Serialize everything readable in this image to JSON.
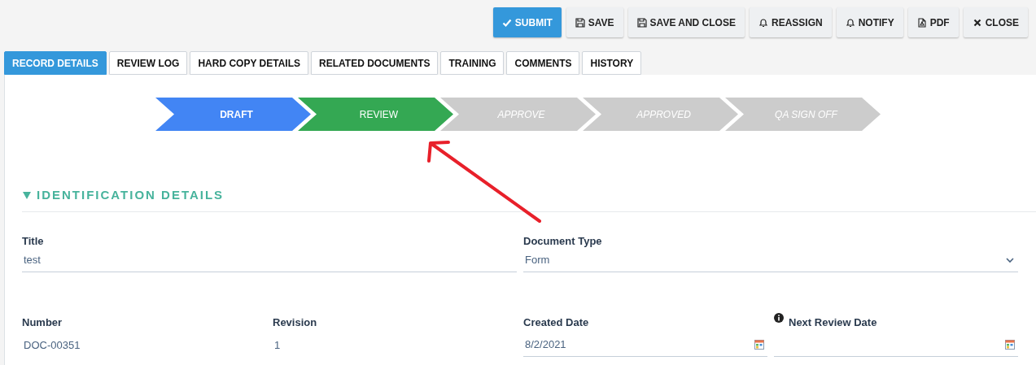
{
  "toolbar": [
    {
      "label": "SUBMIT",
      "primary": true
    },
    {
      "label": "SAVE",
      "primary": false
    },
    {
      "label": "SAVE AND CLOSE",
      "primary": false
    },
    {
      "label": "REASSIGN",
      "primary": false
    },
    {
      "label": "NOTIFY",
      "primary": false
    },
    {
      "label": "PDF",
      "primary": false
    },
    {
      "label": "CLOSE",
      "primary": false
    }
  ],
  "tabs": [
    {
      "label": "RECORD DETAILS",
      "selected": true
    },
    {
      "label": "REVIEW LOG",
      "selected": false
    },
    {
      "label": "HARD COPY DETAILS",
      "selected": false
    },
    {
      "label": "RELATED DOCUMENTS",
      "selected": false
    },
    {
      "label": "TRAINING",
      "selected": false
    },
    {
      "label": "COMMENTS",
      "selected": false
    },
    {
      "label": "HISTORY",
      "selected": false
    }
  ],
  "workflow": [
    {
      "label": "DRAFT",
      "completed": true,
      "selected": false
    },
    {
      "label": "REVIEW",
      "completed": false,
      "selected": true
    },
    {
      "label": "APPROVE",
      "completed": false,
      "selected": false
    },
    {
      "label": "APPROVED",
      "completed": false,
      "selected": false
    },
    {
      "label": "QA SIGN OFF",
      "completed": false,
      "selected": false
    }
  ],
  "section": {
    "title": "IDENTIFICATION DETAILS",
    "expanded": true
  },
  "rows": [
    [
      {
        "label": "Title",
        "value": "test",
        "kind": "text"
      },
      {
        "label": "Document Type",
        "value": "Form",
        "kind": "select"
      }
    ],
    [
      {
        "label": "Number",
        "value": "DOC-00351",
        "kind": "readonly"
      },
      {
        "label": "Revision",
        "value": "1",
        "kind": "readonly"
      },
      {
        "label": "Created Date",
        "value": "8/2/2021",
        "kind": "date"
      },
      {
        "label": "Next Review Date",
        "kind": "date",
        "info": true
      }
    ]
  ]
}
